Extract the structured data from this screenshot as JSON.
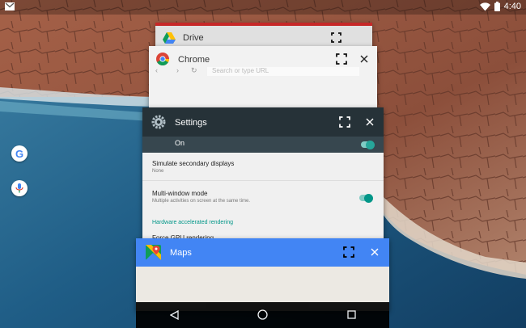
{
  "status_bar": {
    "time": "4:40",
    "icons": [
      "gmail-icon",
      "wifi-icon",
      "battery-icon"
    ]
  },
  "dock": {
    "items": [
      {
        "name": "google-icon",
        "label": "G"
      },
      {
        "name": "voice-search-icon",
        "label": ""
      }
    ]
  },
  "recents": {
    "cards": [
      {
        "app": "Drive",
        "icon": "drive-icon",
        "header_color": "#e0e0e0"
      },
      {
        "app": "Chrome",
        "icon": "chrome-icon",
        "header_color": "#f2f2f2",
        "search_placeholder": "Search or type URL"
      },
      {
        "app": "Settings",
        "icon": "settings-gear-icon",
        "header_color": "#263238"
      },
      {
        "app": "Maps",
        "icon": "maps-icon",
        "header_color": "#4285f4"
      }
    ]
  },
  "settings_content": {
    "top_toggle_label": "On",
    "rows": [
      {
        "title": "Simulate secondary displays",
        "subtitle": "None"
      },
      {
        "title": "Multi-window mode",
        "subtitle": "Multiple activities on screen at the same time."
      }
    ],
    "section_header": "Hardware accelerated rendering",
    "partial_row": "Force GPU rendering"
  },
  "colors": {
    "accent_teal": "#009688",
    "settings_header": "#263238",
    "maps_blue": "#4285f4",
    "drive_red": "#c62828"
  },
  "navigation": {
    "buttons": [
      "back-icon",
      "home-icon",
      "recents-icon"
    ]
  }
}
